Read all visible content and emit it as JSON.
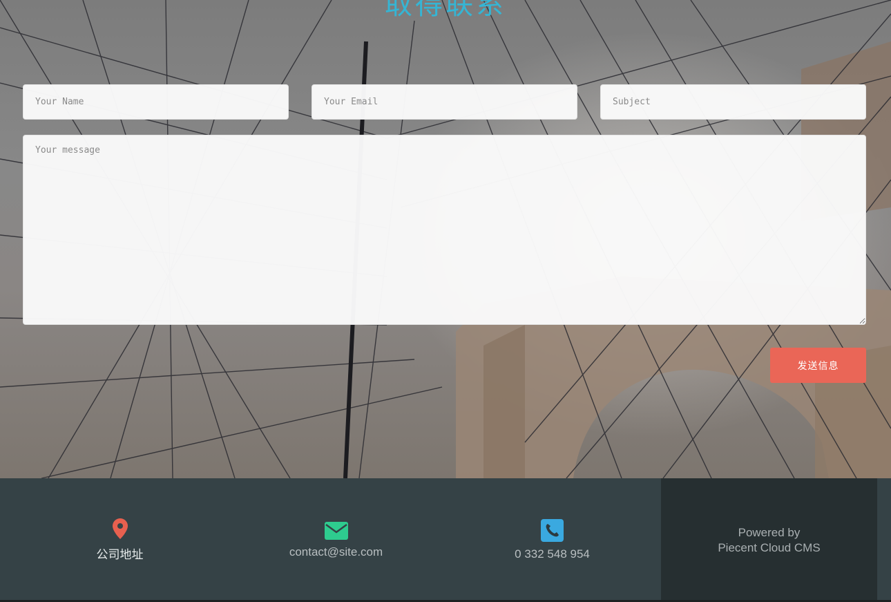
{
  "contact": {
    "title": "取得联系",
    "name_placeholder": "Your Name",
    "email_placeholder": "Your Email",
    "subject_placeholder": "Subject",
    "message_placeholder": "Your message",
    "send_label": "发送信息"
  },
  "footer": {
    "address": {
      "icon": "map-pin-icon",
      "text": "公司地址",
      "color": "#e8604f"
    },
    "email": {
      "icon": "envelope-icon",
      "text": "contact@site.com",
      "color": "#2ecc8f"
    },
    "phone": {
      "icon": "phone-icon",
      "text": "0 332 548 954",
      "color": "#3aa9e0"
    },
    "powered": {
      "line1": "Powered by",
      "line2": "Piecent Cloud CMS"
    }
  },
  "colors": {
    "accent_title": "#35b5d4",
    "button": "#ea6657",
    "footer_bg": "#354246",
    "footer_dark": "#262f31"
  }
}
